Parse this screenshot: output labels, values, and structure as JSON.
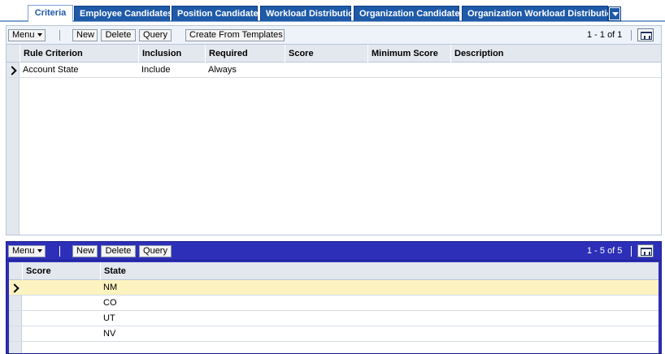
{
  "tabs": [
    {
      "label": "Criteria",
      "active": true
    },
    {
      "label": "Employee Candidates"
    },
    {
      "label": "Position Candidates"
    },
    {
      "label": "Workload Distribution"
    },
    {
      "label": "Organization Candidates"
    },
    {
      "label": "Organization Workload Distribution"
    }
  ],
  "criteria_applet": {
    "toolbar": {
      "menu_label": "Menu",
      "new_label": "New",
      "delete_label": "Delete",
      "query_label": "Query",
      "templates_label": "Create From Templates",
      "record_count": "1 - 1 of 1"
    },
    "columns": [
      "Rule Criterion",
      "Inclusion",
      "Required",
      "Score",
      "Minimum Score",
      "Description"
    ],
    "rows": [
      {
        "rule_criterion": "Account State",
        "inclusion": "Include",
        "required": "Always",
        "score": "",
        "minimum_score": "",
        "description": ""
      }
    ]
  },
  "values_applet": {
    "toolbar": {
      "menu_label": "Menu",
      "new_label": "New",
      "delete_label": "Delete",
      "query_label": "Query",
      "record_count": "1 - 5 of 5"
    },
    "columns": [
      "Score",
      "State"
    ],
    "rows": [
      {
        "score": "",
        "state": "NM"
      },
      {
        "score": "",
        "state": "CO"
      },
      {
        "score": "",
        "state": "UT"
      },
      {
        "score": "",
        "state": "NV"
      }
    ]
  },
  "colors": {
    "tab_blue": "#1e5aa8",
    "active_applet": "#2d2fb8",
    "selected_row": "#fdf3c0"
  }
}
